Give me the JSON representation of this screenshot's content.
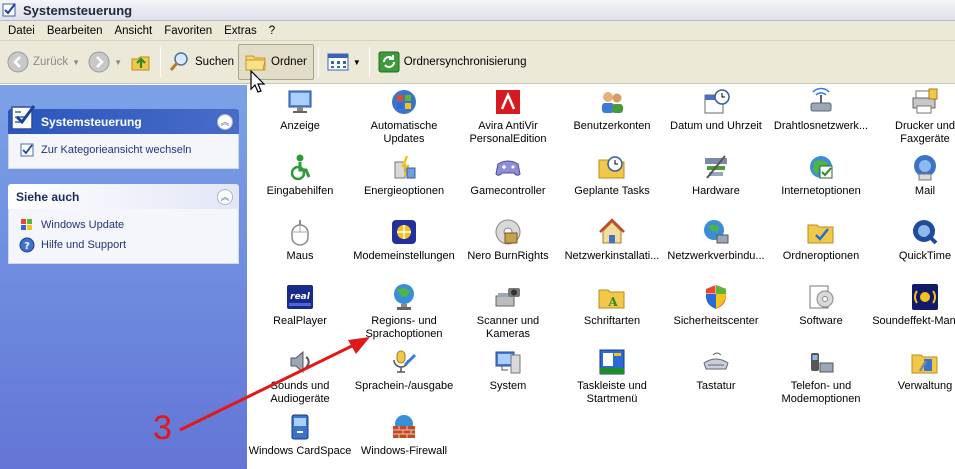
{
  "window": {
    "title": "Systemsteuerung"
  },
  "menu": [
    "Datei",
    "Bearbeiten",
    "Ansicht",
    "Favoriten",
    "Extras",
    "?"
  ],
  "toolbar": {
    "back_label": "Zurück",
    "search_label": "Suchen",
    "folders_label": "Ordner",
    "sync_label": "Ordnersynchronisierung"
  },
  "sidebar": {
    "panel1": {
      "title": "Systemsteuerung",
      "task": "Zur Kategorieansicht wechseln"
    },
    "panel2": {
      "title": "Siehe auch",
      "items": [
        "Windows Update",
        "Hilfe und Support"
      ]
    }
  },
  "items": [
    "Anzeige",
    "Automatische Updates",
    "Avira AntiVir PersonalEdition",
    "Benutzerkonten",
    "Datum und Uhrzeit",
    "Drahtlosnetzwerk...",
    "Drucker und Faxgeräte",
    "Eingabehilfen",
    "Energieoptionen",
    "Gamecontroller",
    "Geplante Tasks",
    "Hardware",
    "Internetoptionen",
    "Mail",
    "Maus",
    "Modemeinstellungen",
    "Nero BurnRights",
    "Netzwerkinstallati...",
    "Netzwerkverbindu...",
    "Ordneroptionen",
    "QuickTime",
    "RealPlayer",
    "Regions- und Sprachoptionen",
    "Scanner und Kameras",
    "Schriftarten",
    "Sicherheitscenter",
    "Software",
    "Soundeffekt-Manager",
    "Sounds und Audiogeräte",
    "Sprachein-/ausgabe",
    "System",
    "Taskleiste und Startmenü",
    "Tastatur",
    "Telefon- und Modemoptionen",
    "Verwaltung",
    "Windows CardSpace",
    "Windows-Firewall"
  ],
  "annotation": {
    "label": "3"
  }
}
